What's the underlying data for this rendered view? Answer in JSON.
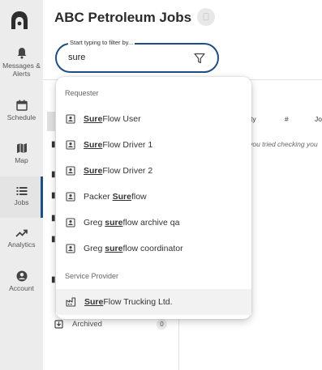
{
  "nav": {
    "items": [
      {
        "label_line1": "Messages &",
        "label_line2": "Alerts",
        "icon": "bell-icon"
      },
      {
        "label": "Schedule",
        "icon": "calendar-icon"
      },
      {
        "label": "Map",
        "icon": "map-icon"
      },
      {
        "label": "Jobs",
        "icon": "list-icon",
        "active": true
      },
      {
        "label": "Analytics",
        "icon": "trending-up-icon"
      },
      {
        "label": "Account",
        "icon": "account-circle-icon"
      }
    ]
  },
  "header": {
    "title": "ABC Petroleum Jobs"
  },
  "filter": {
    "label": "Start typing to filter by...",
    "value": "sure"
  },
  "table": {
    "columns": [
      "ty",
      "#",
      "Jo"
    ],
    "empty_message": "e you tried checking you"
  },
  "sidebar": {
    "archived_label": "Archived",
    "archived_count": "0"
  },
  "dropdown": {
    "groups": [
      {
        "label": "Requester",
        "options": [
          {
            "pre": "",
            "match": "Sure",
            "post": "Flow User"
          },
          {
            "pre": "",
            "match": "Sure",
            "post": "Flow Driver 1"
          },
          {
            "pre": "",
            "match": "Sure",
            "post": "Flow Driver 2"
          },
          {
            "pre": "Packer ",
            "match": "Sure",
            "post": "flow"
          },
          {
            "pre": "Greg ",
            "match": "sure",
            "post": "flow archive qa"
          },
          {
            "pre": "Greg ",
            "match": "sure",
            "post": "flow coordinator"
          }
        ]
      },
      {
        "label": "Service Provider",
        "options": [
          {
            "pre": "",
            "match": "Sure",
            "post": "Flow Trucking Ltd."
          }
        ]
      }
    ]
  },
  "colors": {
    "accent": "#1d4e89",
    "nav_bg": "#ececec",
    "highlight": "#f2f2f2"
  }
}
